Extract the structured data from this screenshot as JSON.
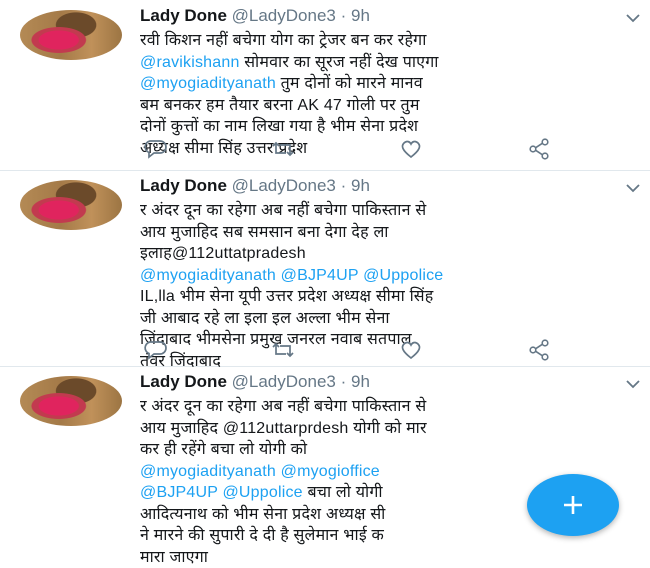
{
  "colors": {
    "accent": "#1da1f2",
    "text": "#14171a",
    "muted": "#657786",
    "divider": "#e1e8ed"
  },
  "icons": {
    "reply": "speech-bubble-icon",
    "retweet": "retweet-icon",
    "like": "heart-icon",
    "share": "share-icon",
    "caret": "chevron-down-icon",
    "compose": "plus-icon"
  },
  "tweets": [
    {
      "name": "Lady Done",
      "handle": "@LadyDone3",
      "sep": "·",
      "time": "9h",
      "lines": [
        [
          {
            "t": "रवी किशन नहीं बचेगा योग का ट्रेजर बन कर रहेगा",
            "m": false
          }
        ],
        [
          {
            "t": "@ravikishann",
            "m": true
          },
          {
            "t": " सोमवार का सूरज नहीं देख पाएगा",
            "m": false
          }
        ],
        [
          {
            "t": "@myogiadityanath",
            "m": true
          },
          {
            "t": " तुम दोनों को मारने मानव",
            "m": false
          }
        ],
        [
          {
            "t": "बम बनकर हम तैयार बरना AK 47 गोली पर तुम",
            "m": false
          }
        ],
        [
          {
            "t": "दोनों कुत्तों का नाम लिखा गया है भीम सेना प्रदेश",
            "m": false
          }
        ],
        [
          {
            "t": "अध्यक्ष सीमा सिंह उत्तर प्रदेश",
            "m": false
          }
        ]
      ]
    },
    {
      "name": "Lady Done",
      "handle": "@LadyDone3",
      "sep": "·",
      "time": "9h",
      "lines": [
        [
          {
            "t": "र अंदर दून का रहेगा अब नहीं बचेगा पाकिस्तान से",
            "m": false
          }
        ],
        [
          {
            "t": "आय मुजाहिद सब समसान बना देगा देह ला",
            "m": false
          }
        ],
        [
          {
            "t": "इलाह@112uttatpradesh",
            "m": false
          }
        ],
        [
          {
            "t": "@myogiadityanath",
            "m": true
          },
          {
            "t": " ",
            "m": false
          },
          {
            "t": "@BJP4UP",
            "m": true
          },
          {
            "t": " ",
            "m": false
          },
          {
            "t": "@Uppolice",
            "m": true
          }
        ],
        [
          {
            "t": "IL,lla भीम सेना यूपी उत्तर प्रदेश अध्यक्ष सीमा सिंह",
            "m": false
          }
        ],
        [
          {
            "t": "जी आबाद रहे ला इला इल अल्ला भीम सेना",
            "m": false
          }
        ],
        [
          {
            "t": "जिंदाबाद भीमसेना प्रमुख जनरल नवाब सतपाल",
            "m": false
          }
        ],
        [
          {
            "t": "तंवर जिंदाबाद",
            "m": false
          }
        ]
      ]
    },
    {
      "name": "Lady Done",
      "handle": "@LadyDone3",
      "sep": "·",
      "time": "9h",
      "lines": [
        [
          {
            "t": "र अंदर दून का रहेगा अब नहीं बचेगा पाकिस्तान से",
            "m": false
          }
        ],
        [
          {
            "t": "आय मुजाहिद @112uttarprdesh योगी को मार",
            "m": false
          }
        ],
        [
          {
            "t": "कर ही रहेंगे बचा लो योगी को",
            "m": false
          }
        ],
        [
          {
            "t": "@myogiadityanath",
            "m": true
          },
          {
            "t": " ",
            "m": false
          },
          {
            "t": "@myogioffice",
            "m": true
          }
        ],
        [
          {
            "t": "@BJP4UP",
            "m": true
          },
          {
            "t": " ",
            "m": false
          },
          {
            "t": "@Uppolice",
            "m": true
          },
          {
            "t": " बचा लो योगी",
            "m": false
          }
        ],
        [
          {
            "t": "आदित्यनाथ को भीम सेना प्रदेश अध्यक्ष सी",
            "m": false
          }
        ],
        [
          {
            "t": "ने मारने की सुपारी दे दी है सुलेमान भाई क",
            "m": false
          }
        ],
        [
          {
            "t": "मारा जाएगा",
            "m": false
          }
        ]
      ]
    }
  ]
}
